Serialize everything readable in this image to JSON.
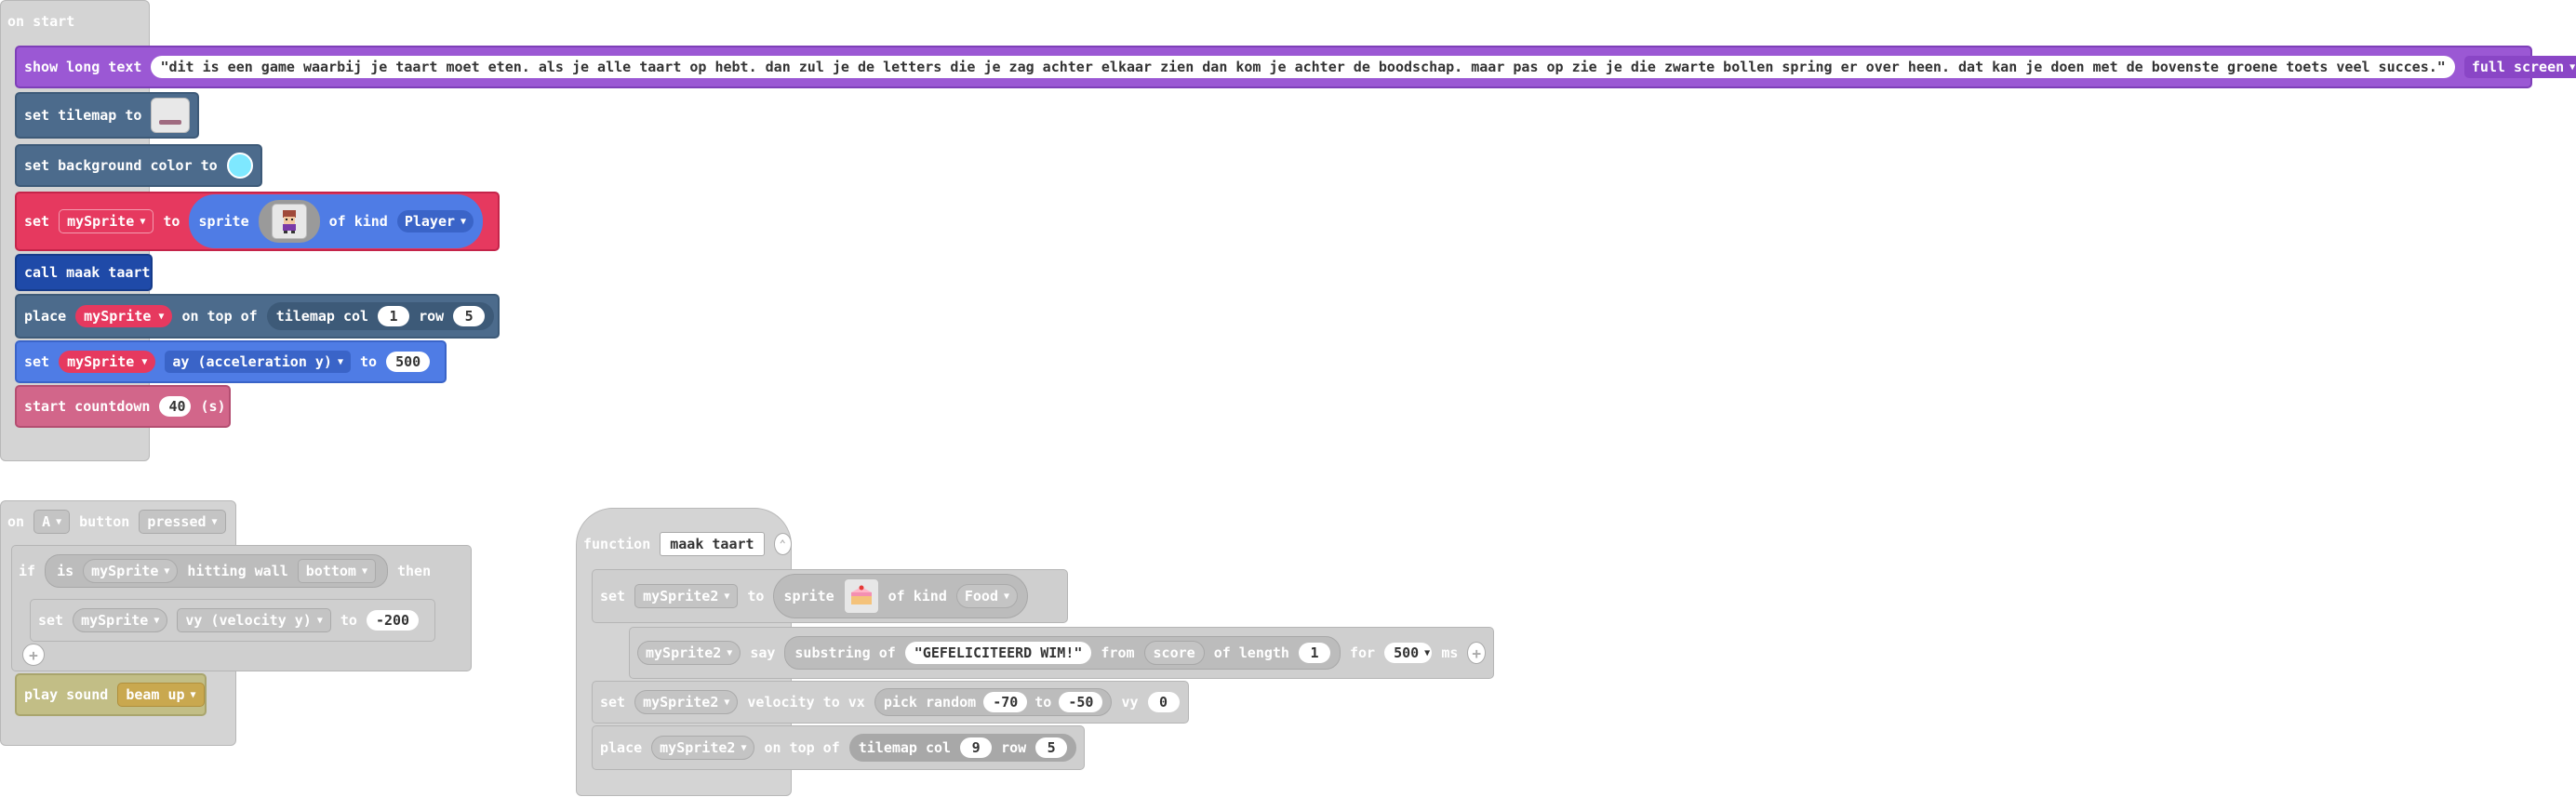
{
  "start": {
    "hat_label": "on start",
    "show_long_text": {
      "label": "show long text",
      "text": "\"dit is een game waarbij je taart moet eten. als je alle taart op hebt. dan zul je de letters die je zag achter elkaar zien dan kom je achter de boodschap. maar pas op zie je die zwarte bollen spring er over heen. dat kan je doen met de bovenste groene toets veel succes.\"",
      "mode": "full screen"
    },
    "set_tilemap": {
      "label": "set tilemap to"
    },
    "set_bg": {
      "label": "set background color to",
      "color": "#7ee8ff"
    },
    "set_sprite": {
      "set": "set",
      "var": "mySprite",
      "to": "to",
      "sprite": "sprite",
      "of_kind": "of kind",
      "kind": "Player"
    },
    "call": {
      "label": "call maak taart"
    },
    "place": {
      "place": "place",
      "var": "mySprite",
      "on_top_of": "on top of",
      "tilemap_col": "tilemap col",
      "col": "1",
      "row_label": "row",
      "row": "5"
    },
    "set_ay": {
      "set": "set",
      "var": "mySprite",
      "prop": "ay (acceleration y)",
      "to": "to",
      "value": "500"
    },
    "countdown": {
      "label": "start countdown",
      "value": "40",
      "unit": "(s)"
    }
  },
  "button_event": {
    "on": "on",
    "button": "A",
    "label": "button",
    "event": "pressed",
    "if_block": {
      "if": "if",
      "is": "is",
      "var": "mySprite",
      "hitting_wall": "hitting wall",
      "wall": "bottom",
      "then": "then",
      "set": "set",
      "set_var": "mySprite",
      "prop": "vy (velocity y)",
      "to": "to",
      "value": "-200"
    },
    "play_sound": {
      "label": "play sound",
      "sound": "beam up"
    }
  },
  "function": {
    "label": "function",
    "name": "maak taart",
    "set_sprite": {
      "set": "set",
      "var": "mySprite2",
      "to": "to",
      "sprite": "sprite",
      "of_kind": "of kind",
      "kind": "Food"
    },
    "say": {
      "var": "mySprite2",
      "say": "say",
      "substring_of": "substring of",
      "text": "\"GEFELICITEERD WIM!\"",
      "from": "from",
      "score": "score",
      "of_length": "of length",
      "length": "1",
      "for": "for",
      "ms_value": "500",
      "ms": "ms"
    },
    "velocity": {
      "set": "set",
      "var": "mySprite2",
      "velocity_to_vx": "velocity to vx",
      "pick_random": "pick random",
      "min": "-70",
      "to": "to",
      "max": "-50",
      "vy": "vy",
      "vy_value": "0"
    },
    "place": {
      "place": "place",
      "var": "mySprite2",
      "on_top_of": "on top of",
      "tilemap_col": "tilemap col",
      "col": "9",
      "row_label": "row",
      "row": "5"
    }
  }
}
